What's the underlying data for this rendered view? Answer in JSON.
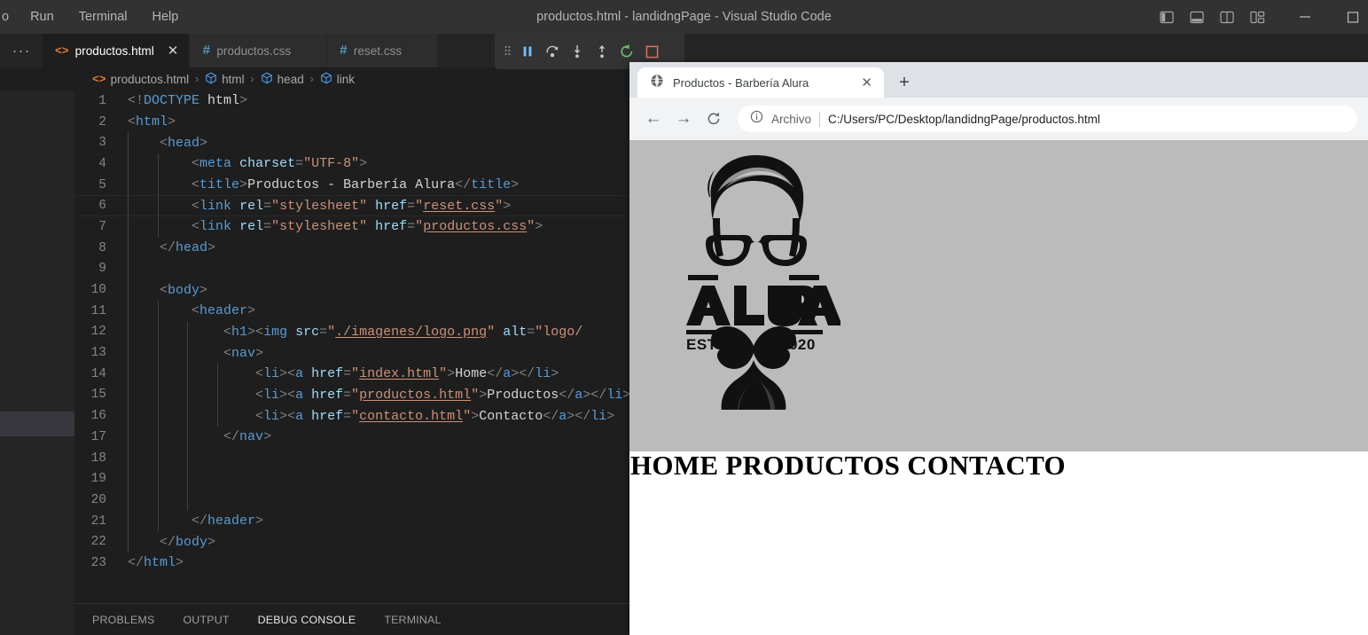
{
  "vscode": {
    "window_title": "productos.html - landidngPage - Visual Studio Code",
    "menu": [
      "o",
      "Run",
      "Terminal",
      "Help"
    ],
    "window_controls": [
      {
        "name": "toggle-primary-sidebar",
        "icon": "panel-left-icon"
      },
      {
        "name": "toggle-panel",
        "icon": "panel-bottom-icon"
      },
      {
        "name": "toggle-secondary-sidebar",
        "icon": "panel-right-icon"
      },
      {
        "name": "customize-layout",
        "icon": "layout-icon"
      },
      {
        "name": "minimize-window",
        "icon": "minimize-icon"
      },
      {
        "name": "maximize-window",
        "icon": "maximize-icon"
      }
    ],
    "tabs_overflow_label": "···",
    "tabs": [
      {
        "label": "productos.html",
        "kind": "html",
        "icon_glyph": "<>",
        "active": true,
        "close_glyph": "✕"
      },
      {
        "label": "productos.css",
        "kind": "css",
        "icon_glyph": "#",
        "active": false,
        "close_glyph": "✕"
      },
      {
        "label": "reset.css",
        "kind": "css",
        "icon_glyph": "#",
        "active": false,
        "close_glyph": "✕"
      }
    ],
    "debug_toolbar": [
      {
        "name": "drag-handle-icon",
        "title": "drag"
      },
      {
        "name": "pause-icon",
        "title": "Pause"
      },
      {
        "name": "step-over-icon",
        "title": "Step Over"
      },
      {
        "name": "step-into-icon",
        "title": "Step Into"
      },
      {
        "name": "step-out-icon",
        "title": "Step Out"
      },
      {
        "name": "restart-icon",
        "title": "Restart"
      },
      {
        "name": "stop-icon",
        "title": "Stop"
      }
    ],
    "breadcrumbs": [
      {
        "label": "productos.html",
        "icon": "html-file-icon"
      },
      {
        "label": "html",
        "icon": "symbol-cube-icon"
      },
      {
        "label": "head",
        "icon": "symbol-cube-icon"
      },
      {
        "label": "link",
        "icon": "symbol-cube-icon"
      }
    ],
    "breadcrumb_separator": "›",
    "panel_tabs": [
      {
        "label": "PROBLEMS",
        "active": false
      },
      {
        "label": "OUTPUT",
        "active": false
      },
      {
        "label": "DEBUG CONSOLE",
        "active": true
      },
      {
        "label": "TERMINAL",
        "active": false
      }
    ],
    "code": {
      "current_line": 6,
      "lines": [
        {
          "n": "1",
          "indent": 0,
          "html": "<span class=\"t-brk\">&lt;!</span><span class=\"t-doc\">DOCTYPE</span> <span class=\"t-txt\">html</span><span class=\"t-brk\">&gt;</span>"
        },
        {
          "n": "2",
          "indent": 0,
          "html": "<span class=\"t-brk\">&lt;</span><span class=\"t-tag\">html</span><span class=\"t-brk\">&gt;</span>"
        },
        {
          "n": "3",
          "indent": 1,
          "html": "    <span class=\"t-brk\">&lt;</span><span class=\"t-tag\">head</span><span class=\"t-brk\">&gt;</span>"
        },
        {
          "n": "4",
          "indent": 2,
          "html": "        <span class=\"t-brk\">&lt;</span><span class=\"t-tag\">meta</span> <span class=\"t-attr\">charset</span><span class=\"t-brk\">=</span><span class=\"t-str\">\"UTF-8\"</span><span class=\"t-brk\">&gt;</span>"
        },
        {
          "n": "5",
          "indent": 2,
          "html": "        <span class=\"t-brk\">&lt;</span><span class=\"t-tag\">title</span><span class=\"t-brk\">&gt;</span><span class=\"t-txt\">Productos - Barbería Alura</span><span class=\"t-brk\">&lt;/</span><span class=\"t-tag\">title</span><span class=\"t-brk\">&gt;</span>"
        },
        {
          "n": "6",
          "indent": 2,
          "html": "        <span class=\"t-brk\">&lt;</span><span class=\"t-tag\">link</span> <span class=\"t-attr\">rel</span><span class=\"t-brk\">=</span><span class=\"t-str\">\"stylesheet\"</span> <span class=\"t-attr\">href</span><span class=\"t-brk\">=</span><span class=\"t-str\">\"</span><span class=\"t-link\">reset.css</span><span class=\"t-str\">\"</span><span class=\"t-brk\">&gt;</span>"
        },
        {
          "n": "7",
          "indent": 2,
          "html": "        <span class=\"t-brk\">&lt;</span><span class=\"t-tag\">link</span> <span class=\"t-attr\">rel</span><span class=\"t-brk\">=</span><span class=\"t-str\">\"stylesheet\"</span> <span class=\"t-attr\">href</span><span class=\"t-brk\">=</span><span class=\"t-str\">\"</span><span class=\"t-link\">productos.css</span><span class=\"t-str\">\"</span><span class=\"t-brk\">&gt;</span>"
        },
        {
          "n": "8",
          "indent": 1,
          "html": "    <span class=\"t-brk\">&lt;/</span><span class=\"t-tag\">head</span><span class=\"t-brk\">&gt;</span>"
        },
        {
          "n": "9",
          "indent": 1,
          "html": ""
        },
        {
          "n": "10",
          "indent": 1,
          "html": "    <span class=\"t-brk\">&lt;</span><span class=\"t-tag\">body</span><span class=\"t-brk\">&gt;</span>"
        },
        {
          "n": "11",
          "indent": 2,
          "html": "        <span class=\"t-brk\">&lt;</span><span class=\"t-tag\">header</span><span class=\"t-brk\">&gt;</span>"
        },
        {
          "n": "12",
          "indent": 3,
          "html": "            <span class=\"t-brk\">&lt;</span><span class=\"t-tag\">h1</span><span class=\"t-brk\">&gt;&lt;</span><span class=\"t-tag\">img</span> <span class=\"t-attr\">src</span><span class=\"t-brk\">=</span><span class=\"t-str\">\"</span><span class=\"t-link\">./imagenes/logo.png</span><span class=\"t-str\">\"</span> <span class=\"t-attr\">alt</span><span class=\"t-brk\">=</span><span class=\"t-str\">\"logo/</span>"
        },
        {
          "n": "13",
          "indent": 3,
          "html": "            <span class=\"t-brk\">&lt;</span><span class=\"t-tag\">nav</span><span class=\"t-brk\">&gt;</span>"
        },
        {
          "n": "14",
          "indent": 4,
          "html": "                <span class=\"t-brk\">&lt;</span><span class=\"t-tag\">li</span><span class=\"t-brk\">&gt;&lt;</span><span class=\"t-tag\">a</span> <span class=\"t-attr\">href</span><span class=\"t-brk\">=</span><span class=\"t-str\">\"</span><span class=\"t-link\">index.html</span><span class=\"t-str\">\"</span><span class=\"t-brk\">&gt;</span><span class=\"t-txt\">Home</span><span class=\"t-brk\">&lt;/</span><span class=\"t-tag\">a</span><span class=\"t-brk\">&gt;&lt;/</span><span class=\"t-tag\">li</span><span class=\"t-brk\">&gt;</span>"
        },
        {
          "n": "15",
          "indent": 4,
          "html": "                <span class=\"t-brk\">&lt;</span><span class=\"t-tag\">li</span><span class=\"t-brk\">&gt;&lt;</span><span class=\"t-tag\">a</span> <span class=\"t-attr\">href</span><span class=\"t-brk\">=</span><span class=\"t-str\">\"</span><span class=\"t-link\">productos.html</span><span class=\"t-str\">\"</span><span class=\"t-brk\">&gt;</span><span class=\"t-txt\">Productos</span><span class=\"t-brk\">&lt;/</span><span class=\"t-tag\">a</span><span class=\"t-brk\">&gt;&lt;/</span><span class=\"t-tag\">li</span><span class=\"t-brk\">&gt;</span>"
        },
        {
          "n": "16",
          "indent": 4,
          "html": "                <span class=\"t-brk\">&lt;</span><span class=\"t-tag\">li</span><span class=\"t-brk\">&gt;&lt;</span><span class=\"t-tag\">a</span> <span class=\"t-attr\">href</span><span class=\"t-brk\">=</span><span class=\"t-str\">\"</span><span class=\"t-link\">contacto.html</span><span class=\"t-str\">\"</span><span class=\"t-brk\">&gt;</span><span class=\"t-txt\">Contacto</span><span class=\"t-brk\">&lt;/</span><span class=\"t-tag\">a</span><span class=\"t-brk\">&gt;&lt;/</span><span class=\"t-tag\">li</span><span class=\"t-brk\">&gt;</span>"
        },
        {
          "n": "17",
          "indent": 3,
          "html": "            <span class=\"t-brk\">&lt;/</span><span class=\"t-tag\">nav</span><span class=\"t-brk\">&gt;</span>"
        },
        {
          "n": "18",
          "indent": 3,
          "html": ""
        },
        {
          "n": "19",
          "indent": 3,
          "html": ""
        },
        {
          "n": "20",
          "indent": 3,
          "html": ""
        },
        {
          "n": "21",
          "indent": 2,
          "html": "        <span class=\"t-brk\">&lt;/</span><span class=\"t-tag\">header</span><span class=\"t-brk\">&gt;</span>"
        },
        {
          "n": "22",
          "indent": 1,
          "html": "    <span class=\"t-brk\">&lt;/</span><span class=\"t-tag\">body</span><span class=\"t-brk\">&gt;</span>"
        },
        {
          "n": "23",
          "indent": 0,
          "html": "<span class=\"t-brk\">&lt;/</span><span class=\"t-tag\">html</span><span class=\"t-brk\">&gt;</span>"
        }
      ]
    }
  },
  "browser": {
    "tab": {
      "title": "Productos - Barbería Alura",
      "favicon": "globe-icon",
      "close_glyph": "✕"
    },
    "new_tab_glyph": "+",
    "nav": {
      "back_glyph": "←",
      "forward_glyph": "→",
      "reload_glyph": "⟳"
    },
    "omnibox": {
      "info_icon": "info-circle-icon",
      "scheme_label": "Archivo",
      "url": "C:/Users/PC/Desktop/landidngPage/productos.html"
    },
    "page": {
      "logo_alt": "ALURA",
      "logo_text": "ALURA",
      "logo_estd": "ESTD",
      "logo_year": "2020",
      "nav_text": "HOME PRODUCTOS CONTACTO",
      "header_bg": "#bbbbbb"
    }
  }
}
